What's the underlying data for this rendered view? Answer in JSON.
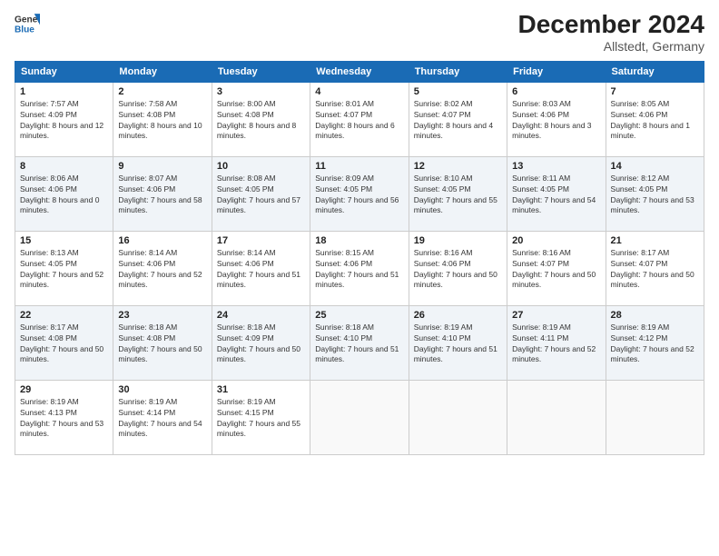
{
  "header": {
    "title": "December 2024",
    "location": "Allstedt, Germany"
  },
  "calendar": {
    "headers": [
      "Sunday",
      "Monday",
      "Tuesday",
      "Wednesday",
      "Thursday",
      "Friday",
      "Saturday"
    ],
    "rows": [
      [
        {
          "day": "1",
          "sunrise": "7:57 AM",
          "sunset": "4:09 PM",
          "daylight": "8 hours and 12 minutes."
        },
        {
          "day": "2",
          "sunrise": "7:58 AM",
          "sunset": "4:08 PM",
          "daylight": "8 hours and 10 minutes."
        },
        {
          "day": "3",
          "sunrise": "8:00 AM",
          "sunset": "4:08 PM",
          "daylight": "8 hours and 8 minutes."
        },
        {
          "day": "4",
          "sunrise": "8:01 AM",
          "sunset": "4:07 PM",
          "daylight": "8 hours and 6 minutes."
        },
        {
          "day": "5",
          "sunrise": "8:02 AM",
          "sunset": "4:07 PM",
          "daylight": "8 hours and 4 minutes."
        },
        {
          "day": "6",
          "sunrise": "8:03 AM",
          "sunset": "4:06 PM",
          "daylight": "8 hours and 3 minutes."
        },
        {
          "day": "7",
          "sunrise": "8:05 AM",
          "sunset": "4:06 PM",
          "daylight": "8 hours and 1 minute."
        }
      ],
      [
        {
          "day": "8",
          "sunrise": "8:06 AM",
          "sunset": "4:06 PM",
          "daylight": "8 hours and 0 minutes."
        },
        {
          "day": "9",
          "sunrise": "8:07 AM",
          "sunset": "4:06 PM",
          "daylight": "7 hours and 58 minutes."
        },
        {
          "day": "10",
          "sunrise": "8:08 AM",
          "sunset": "4:05 PM",
          "daylight": "7 hours and 57 minutes."
        },
        {
          "day": "11",
          "sunrise": "8:09 AM",
          "sunset": "4:05 PM",
          "daylight": "7 hours and 56 minutes."
        },
        {
          "day": "12",
          "sunrise": "8:10 AM",
          "sunset": "4:05 PM",
          "daylight": "7 hours and 55 minutes."
        },
        {
          "day": "13",
          "sunrise": "8:11 AM",
          "sunset": "4:05 PM",
          "daylight": "7 hours and 54 minutes."
        },
        {
          "day": "14",
          "sunrise": "8:12 AM",
          "sunset": "4:05 PM",
          "daylight": "7 hours and 53 minutes."
        }
      ],
      [
        {
          "day": "15",
          "sunrise": "8:13 AM",
          "sunset": "4:05 PM",
          "daylight": "7 hours and 52 minutes."
        },
        {
          "day": "16",
          "sunrise": "8:14 AM",
          "sunset": "4:06 PM",
          "daylight": "7 hours and 52 minutes."
        },
        {
          "day": "17",
          "sunrise": "8:14 AM",
          "sunset": "4:06 PM",
          "daylight": "7 hours and 51 minutes."
        },
        {
          "day": "18",
          "sunrise": "8:15 AM",
          "sunset": "4:06 PM",
          "daylight": "7 hours and 51 minutes."
        },
        {
          "day": "19",
          "sunrise": "8:16 AM",
          "sunset": "4:06 PM",
          "daylight": "7 hours and 50 minutes."
        },
        {
          "day": "20",
          "sunrise": "8:16 AM",
          "sunset": "4:07 PM",
          "daylight": "7 hours and 50 minutes."
        },
        {
          "day": "21",
          "sunrise": "8:17 AM",
          "sunset": "4:07 PM",
          "daylight": "7 hours and 50 minutes."
        }
      ],
      [
        {
          "day": "22",
          "sunrise": "8:17 AM",
          "sunset": "4:08 PM",
          "daylight": "7 hours and 50 minutes."
        },
        {
          "day": "23",
          "sunrise": "8:18 AM",
          "sunset": "4:08 PM",
          "daylight": "7 hours and 50 minutes."
        },
        {
          "day": "24",
          "sunrise": "8:18 AM",
          "sunset": "4:09 PM",
          "daylight": "7 hours and 50 minutes."
        },
        {
          "day": "25",
          "sunrise": "8:18 AM",
          "sunset": "4:10 PM",
          "daylight": "7 hours and 51 minutes."
        },
        {
          "day": "26",
          "sunrise": "8:19 AM",
          "sunset": "4:10 PM",
          "daylight": "7 hours and 51 minutes."
        },
        {
          "day": "27",
          "sunrise": "8:19 AM",
          "sunset": "4:11 PM",
          "daylight": "7 hours and 52 minutes."
        },
        {
          "day": "28",
          "sunrise": "8:19 AM",
          "sunset": "4:12 PM",
          "daylight": "7 hours and 52 minutes."
        }
      ],
      [
        {
          "day": "29",
          "sunrise": "8:19 AM",
          "sunset": "4:13 PM",
          "daylight": "7 hours and 53 minutes."
        },
        {
          "day": "30",
          "sunrise": "8:19 AM",
          "sunset": "4:14 PM",
          "daylight": "7 hours and 54 minutes."
        },
        {
          "day": "31",
          "sunrise": "8:19 AM",
          "sunset": "4:15 PM",
          "daylight": "7 hours and 55 minutes."
        },
        null,
        null,
        null,
        null
      ]
    ]
  }
}
